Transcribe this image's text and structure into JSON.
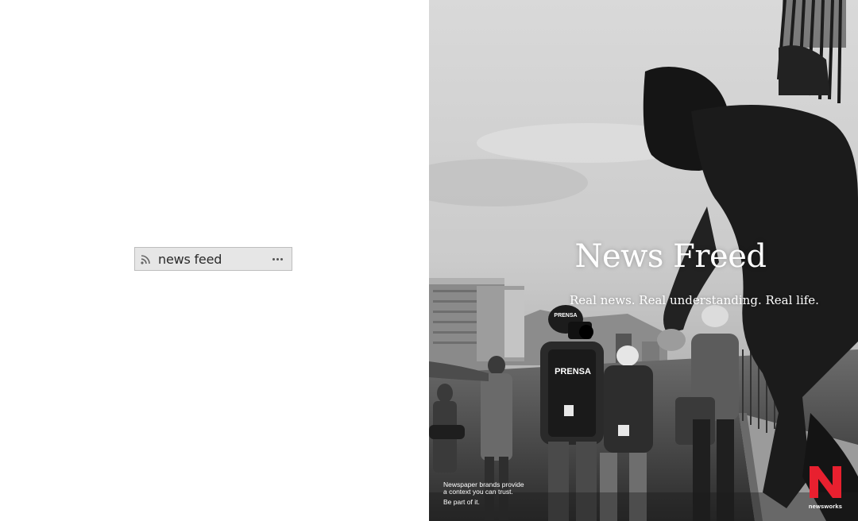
{
  "feed_widget": {
    "label": "news feed",
    "icon": "rss-icon",
    "menu_icon": "more-horizontal-icon"
  },
  "ad": {
    "title": "News Freed",
    "subtitle": "Real news. Real understanding. Real life.",
    "footer_line1": "Newspaper brands provide",
    "footer_line2": "a context you can trust.",
    "footer_cta": "Be part of it.",
    "brand_name": "newsworks",
    "brand_color": "#e8202f",
    "photo_signs": {
      "helmet": "PRENSA",
      "vest": "PRENSA"
    }
  },
  "colors": {
    "widget_bg": "#e6e6e6",
    "widget_border": "#bdbdbd",
    "text_dark": "#2a2a2a"
  }
}
